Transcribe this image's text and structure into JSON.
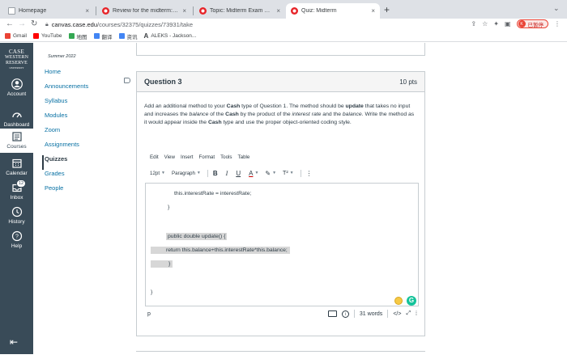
{
  "browser": {
    "tabs": [
      {
        "title": "Homepage",
        "favicon": "doc-icon",
        "active": false
      },
      {
        "title": "Review for the midterm: Introduction",
        "favicon": "canvas-icon",
        "active": false
      },
      {
        "title": "Topic: Midterm Exam Details and",
        "favicon": "canvas-icon",
        "active": false
      },
      {
        "title": "Quiz: Midterm",
        "favicon": "canvas-icon",
        "active": true
      }
    ],
    "new_tab": "+",
    "close_glyph": "×",
    "url_host": "canvas.case.edu",
    "url_path": "/courses/32375/quizzes/73931/take",
    "profile_label": "已暂停",
    "profile_initial": "K",
    "bookmarks": [
      {
        "label": "Gmail",
        "color": "#ea4335"
      },
      {
        "label": "YouTube",
        "color": "#ff0000"
      },
      {
        "label": "地图",
        "color": "#34a853"
      },
      {
        "label": "翻译",
        "color": "#4285f4"
      },
      {
        "label": "资讯",
        "color": "#4285f4"
      },
      {
        "label": "ALEKS - Jackson...",
        "color": "#1a1a1a"
      }
    ]
  },
  "logo": {
    "line1": "CASE",
    "line2": "WESTERN",
    "line3": "RESERVE",
    "line4": "UNIVERSITY"
  },
  "global_nav": [
    {
      "label": "Account",
      "icon": "account-icon"
    },
    {
      "label": "Dashboard",
      "icon": "dashboard-icon"
    },
    {
      "label": "Courses",
      "icon": "courses-icon",
      "active": true
    },
    {
      "label": "Calendar",
      "icon": "calendar-icon"
    },
    {
      "label": "Inbox",
      "icon": "inbox-icon",
      "badge": "12"
    },
    {
      "label": "History",
      "icon": "history-icon"
    },
    {
      "label": "Help",
      "icon": "help-icon"
    }
  ],
  "course_nav": {
    "term": "Summer 2022",
    "items": [
      "Home",
      "Announcements",
      "Syllabus",
      "Modules",
      "Zoom",
      "Assignments",
      "Quizzes",
      "Grades",
      "People"
    ],
    "active": "Quizzes"
  },
  "question": {
    "title": "Question 3",
    "points": "10 pts",
    "text": {
      "p1": "Add an additional method to your ",
      "b1": "Cash",
      "p2": " type of Question 1. The method should be ",
      "b2": "update",
      "p3": " that takes no input and increases the ",
      "i1": "balance",
      "p4": " of the ",
      "b3": "Cash",
      "p5": " by the product of the ",
      "i2": "interest rate",
      "p6": " and the ",
      "i3": "balance",
      "p7": ". Write the method as it would appear inside the ",
      "b4": "Cash",
      "p8": " type and use the proper object-oriented coding style."
    }
  },
  "editor": {
    "menu": [
      "Edit",
      "View",
      "Insert",
      "Format",
      "Tools",
      "Table"
    ],
    "font_size": "12pt",
    "block_format": "Paragraph",
    "code_lines": [
      "this.interestRate = interestRate;",
      "}",
      "public double update() {",
      "return this.balance+this.interestRate*this.balance;",
      "}",
      "}"
    ],
    "status_path": "p",
    "word_count": "31 words",
    "html_toggle": "</>",
    "fullscreen": "⤢",
    "resize": "⁞"
  }
}
